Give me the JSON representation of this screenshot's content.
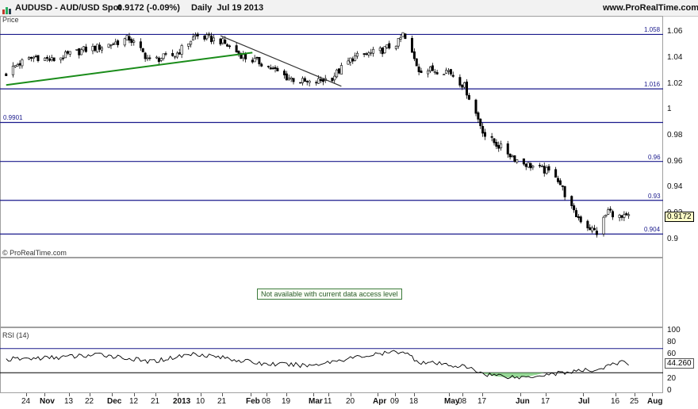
{
  "header": {
    "symbol": "AUDUSD - AUD/USD Spot",
    "last_price": "0.9172 (-0.09%)",
    "period_date": "Daily  Jul 19 2013",
    "site": "www.ProRealTime.com"
  },
  "price_panel": {
    "label": "Price",
    "watermark": "© ProRealTime.com",
    "current_price": "0.9172",
    "y_ticks": [
      "1.06",
      "1.04",
      "1.02",
      "1",
      "0.98",
      "0.96",
      "0.94",
      "0.92",
      "0.9"
    ],
    "levels": [
      {
        "value": 1.058,
        "label": "1.058"
      },
      {
        "value": 1.016,
        "label": "1.016"
      },
      {
        "value": 0.9901,
        "label": "0.9901"
      },
      {
        "value": 0.96,
        "label": "0.96"
      },
      {
        "value": 0.93,
        "label": "0.93"
      },
      {
        "value": 0.904,
        "label": "0.904"
      }
    ]
  },
  "middle_panel": {
    "notice": "Not available with current data access level"
  },
  "rsi_panel": {
    "label": "RSI (14)",
    "current_value": "44.260",
    "y_ticks": [
      "100",
      "80",
      "60",
      "20",
      "0"
    ]
  },
  "x_axis": {
    "ticks": [
      "24",
      "Nov",
      "13",
      "22",
      "Dec",
      "12",
      "21",
      "2013",
      "10",
      "21",
      "Feb",
      "08",
      "19",
      "Mar",
      "11",
      "20",
      "Apr",
      "09",
      "18",
      "May",
      "08",
      "17",
      "Jun",
      "17",
      "Jul",
      "16",
      "25",
      "Aug"
    ]
  },
  "colors": {
    "level_line": "#1a1a8c",
    "uptrend_line": "#1a8c1a",
    "downtrend_line": "#333333",
    "rsi_line": "#000000",
    "rsi_oversold_fill": "#7ccf7c"
  },
  "chart_data": {
    "type": "candlestick",
    "title": "AUDUSD - AUD/USD Spot",
    "period": "Daily",
    "ylim": [
      0.895,
      1.065
    ],
    "close_path": [
      [
        "Oct 19 2012",
        1.028
      ],
      [
        "Oct 24 2012",
        1.035
      ],
      [
        "Nov 01 2012",
        1.041
      ],
      [
        "Nov 08 2012",
        1.038
      ],
      [
        "Nov 13 2012",
        1.041
      ],
      [
        "Nov 22 2012",
        1.046
      ],
      [
        "Dec 01 2012",
        1.049
      ],
      [
        "Dec 12 2012",
        1.055
      ],
      [
        "Dec 21 2012",
        1.038
      ],
      [
        "Jan 01 2013",
        1.042
      ],
      [
        "Jan 10 2013",
        1.057
      ],
      [
        "Jan 21 2013",
        1.053
      ],
      [
        "Feb 01 2013",
        1.04
      ],
      [
        "Feb 08 2013",
        1.036
      ],
      [
        "Feb 19 2013",
        1.025
      ],
      [
        "Mar 01 2013",
        1.02
      ],
      [
        "Mar 11 2013",
        1.025
      ],
      [
        "Mar 20 2013",
        1.04
      ],
      [
        "Apr 01 2013",
        1.045
      ],
      [
        "Apr 09 2013",
        1.052
      ],
      [
        "Apr 11 2013",
        1.058
      ],
      [
        "Apr 18 2013",
        1.031
      ],
      [
        "May 01 2013",
        1.03
      ],
      [
        "May 08 2013",
        1.018
      ],
      [
        "May 17 2013",
        0.98
      ],
      [
        "Jun 01 2013",
        0.96
      ],
      [
        "Jun 17 2013",
        0.95
      ],
      [
        "Jun 25 2013",
        0.92
      ],
      [
        "Jul 01 2013",
        0.91
      ],
      [
        "Jul 05 2013",
        0.905
      ],
      [
        "Jul 10 2013",
        0.922
      ],
      [
        "Jul 16 2013",
        0.916
      ],
      [
        "Jul 19 2013",
        0.9172
      ]
    ],
    "horizontal_levels": [
      1.058,
      1.016,
      0.9901,
      0.96,
      0.93,
      0.904
    ],
    "trendlines": [
      {
        "kind": "uptrend",
        "from": [
          "Oct 19 2012",
          1.019
        ],
        "to": [
          "Feb 04 2013",
          1.044
        ]
      },
      {
        "kind": "downtrend",
        "from": [
          "Jan 21 2013",
          1.057
        ],
        "to": [
          "Mar 15 2013",
          1.018
        ]
      }
    ],
    "rsi": {
      "name": "RSI (14)",
      "ylim": [
        0,
        100
      ],
      "bands": [
        30,
        70
      ],
      "last": 44.26,
      "path": [
        [
          "Oct 19 2012",
          52
        ],
        [
          "Nov 08 2012",
          55
        ],
        [
          "Dec 01 2012",
          60
        ],
        [
          "Dec 21 2012",
          48
        ],
        [
          "Jan 10 2013",
          62
        ],
        [
          "Feb 08 2013",
          45
        ],
        [
          "Mar 01 2013",
          42
        ],
        [
          "Mar 20 2013",
          55
        ],
        [
          "Apr 11 2013",
          66
        ],
        [
          "Apr 18 2013",
          48
        ],
        [
          "May 08 2013",
          40
        ],
        [
          "May 17 2013",
          28
        ],
        [
          "Jun 01 2013",
          22
        ],
        [
          "Jun 10 2013",
          26
        ],
        [
          "Jun 25 2013",
          32
        ],
        [
          "Jul 05 2013",
          35
        ],
        [
          "Jul 16 2013",
          48
        ],
        [
          "Jul 19 2013",
          44.26
        ]
      ]
    }
  }
}
